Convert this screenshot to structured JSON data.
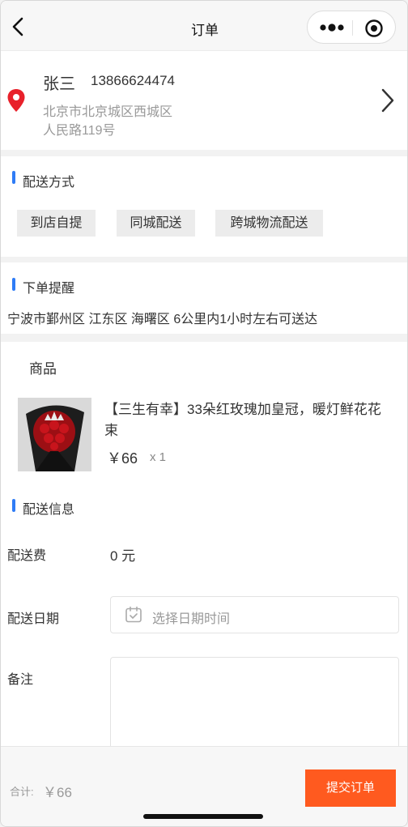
{
  "nav": {
    "title": "订单"
  },
  "address": {
    "name": "张三",
    "phone": "13866624474",
    "line1": "北京市北京城区西城区",
    "line2": "人民路119号"
  },
  "delivery_method": {
    "title": "配送方式",
    "options": [
      "到店自提",
      "同城配送",
      "跨城物流配送"
    ]
  },
  "reminder": {
    "title": "下单提醒",
    "text": "宁波市鄞州区 江东区 海曙区 6公里内1小时左右可送达"
  },
  "goods": {
    "title": "商品",
    "name": "【三生有幸】33朵红玫瑰加皇冠，暖灯鲜花花束",
    "price": "￥66",
    "qty": "x 1"
  },
  "delivery_info": {
    "title": "配送信息",
    "fee_label": "配送费",
    "fee_value": "0 元",
    "date_label": "配送日期",
    "date_placeholder": "选择日期时间",
    "note_label": "备注"
  },
  "footer": {
    "total_label": "合计:",
    "total_value": "￥66",
    "submit_label": "提交订单"
  },
  "colors": {
    "accent_blue": "#2f7cf6",
    "submit_orange": "#ff5a1f",
    "pin_red": "#e8212b"
  }
}
